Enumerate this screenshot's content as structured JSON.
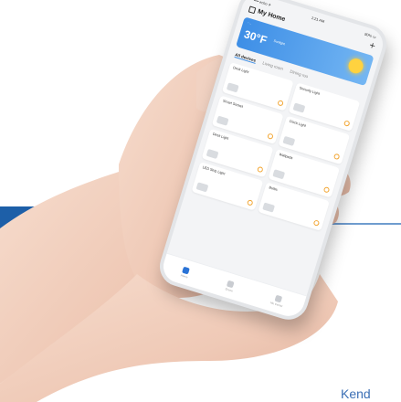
{
  "phone": {
    "status_carrier": "•••• echo ✈",
    "status_time": "1:21 AM",
    "status_battery": "80% ▭",
    "home_title": "My Home",
    "weather": {
      "location": "◦ ...",
      "temp": "30°F",
      "condition": "Sunlight"
    },
    "tabs": [
      {
        "label": "All devices"
      },
      {
        "label": "Living room"
      },
      {
        "label": "Dining roo"
      }
    ],
    "devices": [
      {
        "name": "Desk Light",
        "status": ""
      },
      {
        "name": "Security Light",
        "status": ""
      },
      {
        "name": "Smart Socket",
        "status": ""
      },
      {
        "name": "Clock Light",
        "status": ""
      },
      {
        "name": "Desk Light",
        "status": ""
      },
      {
        "name": "Wallpads",
        "status": ""
      },
      {
        "name": "LED Strip Light",
        "status": ""
      },
      {
        "name": "Bulbs",
        "status": ""
      }
    ],
    "nav": [
      {
        "label": "Home"
      },
      {
        "label": "Scene"
      },
      {
        "label": "Me Center"
      }
    ]
  },
  "corner_text": "Kend",
  "colors": {
    "accent": "#1d5fa8",
    "weather": "#3d8ee6",
    "power": "#f2a531"
  }
}
